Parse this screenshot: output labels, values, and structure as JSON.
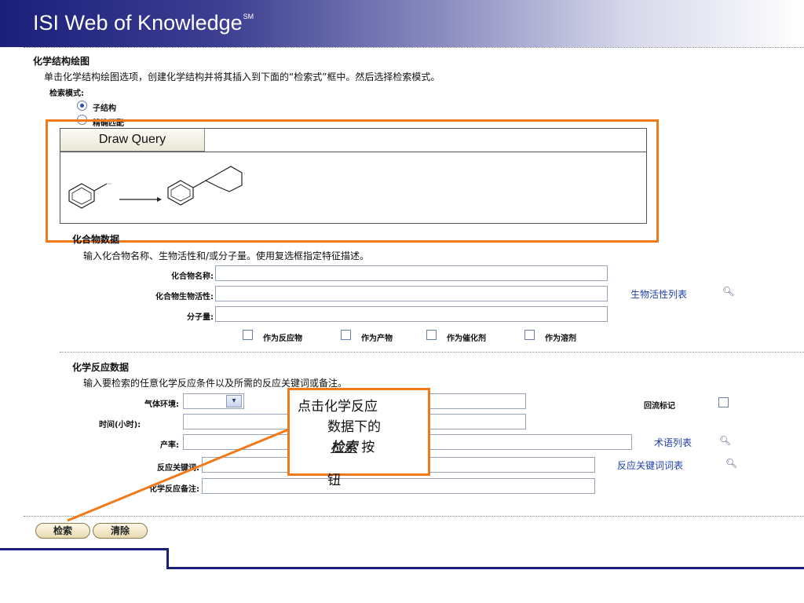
{
  "header": {
    "title": "ISI Web of Knowledge",
    "trademark": "SM"
  },
  "structure_section": {
    "title": "化学结构绘图",
    "description": "单击化学结构绘图选项，创建化学结构并将其插入到下面的“检索式”框中。然后选择检索模式。",
    "search_mode_label": "检索模式:",
    "modes": [
      {
        "label": "子结构",
        "selected": true
      },
      {
        "label": "精确匹配",
        "selected": false
      }
    ],
    "draw_query_tab": "Draw Query"
  },
  "compound_section": {
    "title": "化合物数据",
    "description": "输入化合物名称、生物活性和/或分子量。使用复选框指定特征描述。",
    "fields": [
      {
        "label": "化合物名称:",
        "value": ""
      },
      {
        "label": "化合物生物活性:",
        "value": "",
        "link": "生物活性列表"
      },
      {
        "label": "分子量:",
        "value": ""
      }
    ],
    "checkboxes": [
      "作为反应物",
      "作为产物",
      "作为催化剂",
      "作为溶剂"
    ]
  },
  "reaction_section": {
    "title": "化学反应数据",
    "description": "输入要检索的任意化学反应条件以及所需的反应关键词或备注。",
    "fields": [
      {
        "label": "气体环境:",
        "value": ""
      },
      {
        "label": "时间(小时):",
        "value": ""
      },
      {
        "label": "产率:",
        "value": "",
        "link": "术语列表"
      },
      {
        "label": "反应关键词:",
        "value": "",
        "link": "反应关键词词表"
      },
      {
        "label": "化学反应备注:",
        "value": ""
      }
    ],
    "reflux_label": "回流标记"
  },
  "buttons": {
    "search": "检索",
    "clear": "清除"
  },
  "callout": {
    "line1": "点击化学反应",
    "line2": "数据下的",
    "line3_emph": "检索",
    "line3_rest": " 按",
    "line4": "钮"
  },
  "colors": {
    "accent_orange": "#f07a1a",
    "header_dark": "#1a1f7a",
    "link_blue": "#1f3fa8"
  }
}
